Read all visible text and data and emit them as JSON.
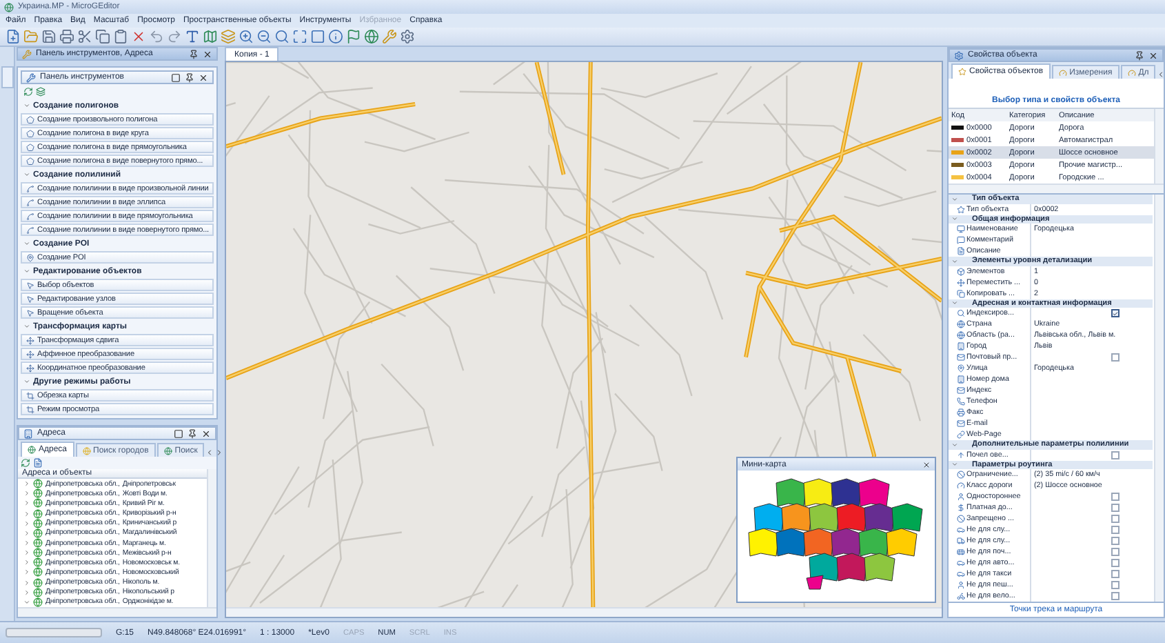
{
  "window": {
    "title": "Украина.MP - MicroGEditor"
  },
  "menu": [
    {
      "label": "Файл",
      "disabled": false
    },
    {
      "label": "Правка",
      "disabled": false
    },
    {
      "label": "Вид",
      "disabled": false
    },
    {
      "label": "Масштаб",
      "disabled": false
    },
    {
      "label": "Просмотр",
      "disabled": false
    },
    {
      "label": "Пространственные объекты",
      "disabled": false
    },
    {
      "label": "Инструменты",
      "disabled": false
    },
    {
      "label": "Избранное",
      "disabled": true
    },
    {
      "label": "Справка",
      "disabled": false
    }
  ],
  "left_panel": {
    "title": "Панель инструментов, Адреса"
  },
  "tools": {
    "title": "Панель инструментов",
    "sections": [
      {
        "kind": "polygon",
        "title": "Создание полигонов",
        "items": [
          "Создание произвольного полигона",
          "Создание полигона в виде круга",
          "Создание полигона в виде прямоугольника",
          "Создание полигона в виде повернутого прямо..."
        ]
      },
      {
        "kind": "polyline",
        "title": "Создание полилиний",
        "items": [
          "Создание полилинии в виде произвольной линии",
          "Создание полилинии в виде эллипса",
          "Создание полилинии в виде прямоугольника",
          "Создание полилинии в виде повернутого прямо..."
        ]
      },
      {
        "kind": "poi",
        "title": "Создание POI",
        "items": [
          "Создание POI"
        ]
      },
      {
        "kind": "edit",
        "title": "Редактирование объектов",
        "items": [
          "Выбор объектов",
          "Редактирование узлов",
          "Вращение объекта"
        ]
      },
      {
        "kind": "transform",
        "title": "Трансформация карты",
        "items": [
          "Трансформация сдвига",
          "Аффинное преобразование",
          "Координатное преобразование"
        ]
      },
      {
        "kind": "other",
        "title": "Другие режимы работы",
        "items": [
          "Обрезка карты",
          "Режим просмотра"
        ]
      }
    ]
  },
  "addresses": {
    "title": "Адреса",
    "tabs": [
      {
        "label": "Адреса",
        "selected": true
      },
      {
        "label": "Поиск городов",
        "selected": false
      },
      {
        "label": "Поиск",
        "selected": false
      }
    ],
    "column": "Адреса и объекты",
    "rows": [
      {
        "region": "Дніпропетровська обл.,",
        "place": "Дніпропетровськ",
        "expanded": false
      },
      {
        "region": "Дніпропетровська обл.,",
        "place": "Жовті Води м.",
        "expanded": false
      },
      {
        "region": "Дніпропетровська обл.,",
        "place": "Кривий Ріг м.",
        "expanded": false
      },
      {
        "region": "Дніпропетровська обл.,",
        "place": "Криворізький р-н",
        "expanded": false
      },
      {
        "region": "Дніпропетровська обл.,",
        "place": "Криничанський р",
        "expanded": false
      },
      {
        "region": "Дніпропетровська обл.,",
        "place": "Магдалинівський",
        "expanded": false
      },
      {
        "region": "Дніпропетровська обл.,",
        "place": "Марганець м.",
        "expanded": false
      },
      {
        "region": "Дніпропетровська обл.,",
        "place": "Межівський р-н",
        "expanded": false
      },
      {
        "region": "Дніпропетровська обл.,",
        "place": "Новомосковськ м.",
        "expanded": false
      },
      {
        "region": "Дніпропетровська обл.,",
        "place": "Новомосковський",
        "expanded": false
      },
      {
        "region": "Дніпропетровська обл.,",
        "place": "Нікополь м.",
        "expanded": false
      },
      {
        "region": "Дніпропетровська обл.,",
        "place": "Нікопольський р",
        "expanded": false
      },
      {
        "region": "Дніпропетровська обл.,",
        "place": "Орджонікідзе м.",
        "expanded": true
      }
    ]
  },
  "map": {
    "tab": "Копия - 1",
    "minimap_title": "Мини-карта"
  },
  "properties": {
    "title": "Свойства объекта",
    "tabs": [
      {
        "label": "Свойства объектов",
        "selected": true
      },
      {
        "label": "Измерения",
        "selected": false
      },
      {
        "label": "Дл",
        "selected": false
      }
    ],
    "type_link": "Выбор типа и свойств объекта",
    "columns": [
      "Код",
      "Категория",
      "Описание"
    ],
    "types": [
      {
        "code": "0x0000",
        "category": "Дороги",
        "description": "Дорога",
        "color": "#111111",
        "selected": false
      },
      {
        "code": "0x0001",
        "category": "Дороги",
        "description": "Автомагистрал",
        "color": "#c0504d",
        "selected": false
      },
      {
        "code": "0x0002",
        "category": "Дороги",
        "description": "Шоссе основное",
        "color": "#e8a317",
        "selected": true
      },
      {
        "code": "0x0003",
        "category": "Дороги",
        "description": "Прочие магистр...",
        "color": "#7a5c1e",
        "selected": false
      },
      {
        "code": "0x0004",
        "category": "Дороги",
        "description": "Городские ...",
        "color": "#f5c242",
        "selected": false
      }
    ],
    "groups": [
      {
        "title": "Тип объекта",
        "expanded": true,
        "rows": [
          {
            "kind": "text",
            "label": "Тип объекта",
            "value": "0x0002"
          }
        ]
      },
      {
        "title": "Общая информация",
        "expanded": true,
        "rows": [
          {
            "kind": "text",
            "label": "Наименование",
            "value": "Городецька"
          },
          {
            "kind": "text",
            "label": "Комментарий"
          },
          {
            "kind": "text",
            "label": "Описание"
          }
        ]
      },
      {
        "title": "Элементы уровня детализации",
        "expanded": true,
        "rows": [
          {
            "kind": "text",
            "label": "Элементов",
            "value": "1"
          },
          {
            "kind": "text",
            "label": "Переместить ...",
            "value": "0"
          },
          {
            "kind": "text",
            "label": "Копировать ...",
            "value": "2"
          }
        ]
      },
      {
        "title": "Адресная и контактная информация",
        "expanded": true,
        "rows": [
          {
            "kind": "check",
            "label": "Индексиров...",
            "checked": true
          },
          {
            "kind": "text",
            "label": "Страна",
            "value": "Ukraine"
          },
          {
            "kind": "text",
            "label": "Область (ра...",
            "value": "Львівська обл., Львів м."
          },
          {
            "kind": "text",
            "label": "Город",
            "value": "Львів"
          },
          {
            "kind": "check",
            "label": "Почтовый пр...",
            "checked": false
          },
          {
            "kind": "text",
            "label": "Улица",
            "value": "Городецька"
          },
          {
            "kind": "text",
            "label": "Номер дома"
          },
          {
            "kind": "text",
            "label": "Индекс"
          },
          {
            "kind": "text",
            "label": "Телефон"
          },
          {
            "kind": "text",
            "label": "Факс"
          },
          {
            "kind": "text",
            "label": "E-mail"
          },
          {
            "kind": "text",
            "label": "Web-Page"
          }
        ]
      },
      {
        "title": "Дополнительные параметры полилинии",
        "expanded": true,
        "rows": [
          {
            "kind": "check",
            "label": "Почел ове...",
            "checked": false
          }
        ]
      },
      {
        "title": "Параметры роутинга",
        "expanded": true,
        "rows": [
          {
            "kind": "text",
            "label": "Ограничение...",
            "value": "(2) 35 mi/c / 60 км/ч"
          },
          {
            "kind": "text",
            "label": "Класс дороги",
            "value": "(2) Шоссе основное"
          },
          {
            "kind": "check",
            "label": "Одностороннее",
            "checked": false
          },
          {
            "kind": "check",
            "label": "Платная до...",
            "checked": false
          },
          {
            "kind": "check",
            "label": "Запрещено ...",
            "checked": false
          },
          {
            "kind": "check",
            "label": "Не для слу...",
            "checked": false
          },
          {
            "kind": "check",
            "label": "Не для слу...",
            "checked": false
          },
          {
            "kind": "check",
            "label": "Не для поч...",
            "checked": false
          },
          {
            "kind": "check",
            "label": "Не для авто...",
            "checked": false
          },
          {
            "kind": "check",
            "label": "Не для такси",
            "checked": false
          },
          {
            "kind": "check",
            "label": "Не для пеш...",
            "checked": false
          },
          {
            "kind": "check",
            "label": "Не для вело...",
            "checked": false
          }
        ]
      }
    ],
    "footer": "Точки трека и маршрута"
  },
  "status_bar": {
    "zoom": "G:15",
    "coords": "N49.848068° E24.016991°",
    "scale": "1 : 13000",
    "level": "*Lev0",
    "keys": [
      {
        "label": "CAPS",
        "on": false
      },
      {
        "label": "NUM",
        "on": true
      },
      {
        "label": "SCRL",
        "on": false
      },
      {
        "label": "INS",
        "on": false
      }
    ]
  }
}
